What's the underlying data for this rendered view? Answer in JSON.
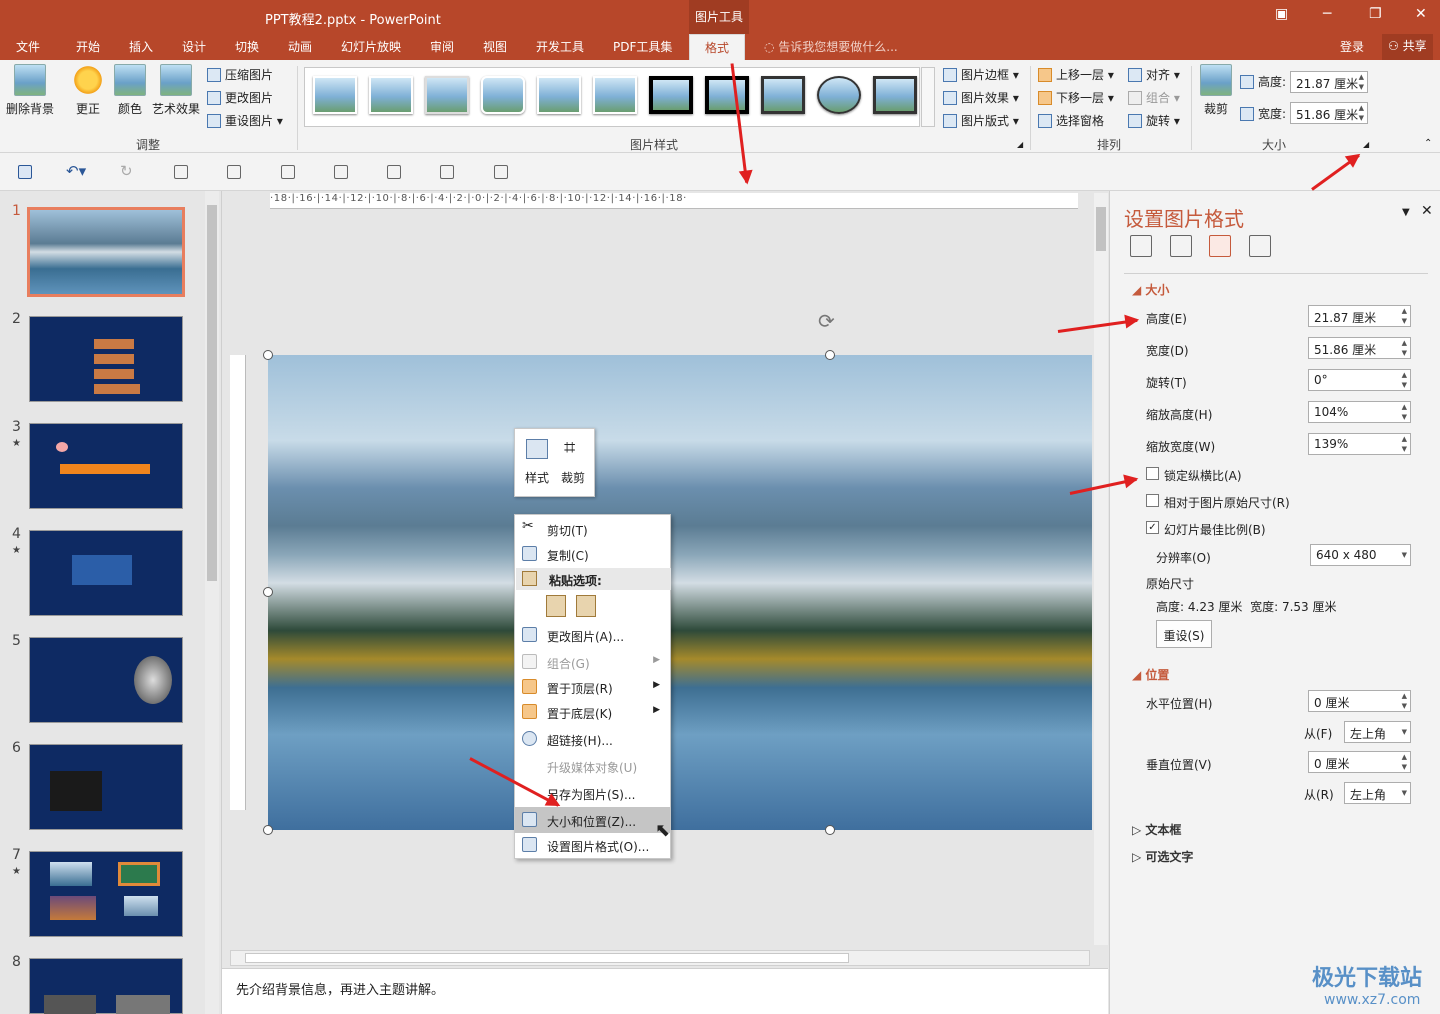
{
  "window": {
    "title": "PPT教程2.pptx - PowerPoint",
    "context_tab_header": "图片工具",
    "minimize": "─",
    "restore": "❐",
    "close": "✕",
    "ribbon_display": "▣"
  },
  "tabs": [
    "文件",
    "开始",
    "插入",
    "设计",
    "切换",
    "动画",
    "幻灯片放映",
    "审阅",
    "视图",
    "开发工具",
    "PDF工具集",
    "格式"
  ],
  "active_tab": "格式",
  "tellme": "告诉我您想要做什么...",
  "account": {
    "login": "登录",
    "share": "共享"
  },
  "ribbon": {
    "adjust": {
      "remove_bg": "删除背景",
      "corrections": "更正",
      "color": "颜色",
      "artistic": "艺术效果",
      "compress": "压缩图片",
      "change": "更改图片",
      "reset": "重设图片",
      "label": "调整"
    },
    "styles": {
      "label": "图片样式",
      "border": "图片边框",
      "effects": "图片效果",
      "layout": "图片版式"
    },
    "arrange": {
      "forward": "上移一层",
      "backward": "下移一层",
      "selection_pane": "选择窗格",
      "align": "对齐",
      "group": "组合",
      "rotate": "旋转",
      "label": "排列"
    },
    "size": {
      "crop": "裁剪",
      "height_label": "高度:",
      "height_value": "21.87 厘米",
      "width_label": "宽度:",
      "width_value": "51.86 厘米",
      "label": "大小"
    }
  },
  "slides": [
    {
      "num": "1",
      "star": ""
    },
    {
      "num": "2",
      "star": ""
    },
    {
      "num": "3",
      "star": "★"
    },
    {
      "num": "4",
      "star": "★"
    },
    {
      "num": "5",
      "star": ""
    },
    {
      "num": "6",
      "star": ""
    },
    {
      "num": "7",
      "star": "★"
    },
    {
      "num": "8",
      "star": ""
    }
  ],
  "ruler": {
    "h": "·18·|·16·|·14·|·12·|·10·|·8·|·6·|·4·|·2·|·0·|·2·|·4·|·6·|·8·|·10·|·12·|·14·|·16·|·18·"
  },
  "mini_toolbar": {
    "style": "样式",
    "crop": "裁剪"
  },
  "context_menu": {
    "cut": "剪切(T)",
    "copy": "复制(C)",
    "paste_options": "粘贴选项:",
    "change_picture": "更改图片(A)...",
    "group": "组合(G)",
    "bring_front": "置于顶层(R)",
    "send_back": "置于底层(K)",
    "hyperlink": "超链接(H)...",
    "upgrade_media": "升级媒体对象(U)",
    "save_as_picture": "另存为图片(S)...",
    "size_position": "大小和位置(Z)...",
    "format_picture": "设置图片格式(O)..."
  },
  "notes": "先介绍背景信息，再进入主题讲解。",
  "pane": {
    "title": "设置图片格式",
    "size_section": "大小",
    "height_label": "高度(E)",
    "height_value": "21.87 厘米",
    "width_label": "宽度(D)",
    "width_value": "51.86 厘米",
    "rotation_label": "旋转(T)",
    "rotation_value": "0°",
    "scale_h_label": "缩放高度(H)",
    "scale_h_value": "104%",
    "scale_w_label": "缩放宽度(W)",
    "scale_w_value": "139%",
    "lock_aspect": "锁定纵横比(A)",
    "relative_original": "相对于图片原始尺寸(R)",
    "best_scale": "幻灯片最佳比例(B)",
    "resolution_label": "分辨率(O)",
    "resolution_value": "640 x 480",
    "original_size": "原始尺寸",
    "orig_h_label": "高度:",
    "orig_h_value": "4.23 厘米",
    "orig_w_label": "宽度:",
    "orig_w_value": "7.53 厘米",
    "reset": "重设(S)",
    "position_section": "位置",
    "hpos_label": "水平位置(H)",
    "hpos_value": "0 厘米",
    "from1_label": "从(F)",
    "from1_value": "左上角",
    "vpos_label": "垂直位置(V)",
    "vpos_value": "0 厘米",
    "from2_label": "从(R)",
    "from2_value": "左上角",
    "textbox_section": "文本框",
    "alt_text_section": "可选文字"
  },
  "watermark": {
    "brand": "极光下载站",
    "url": "www.xz7.com"
  },
  "colors": {
    "accent": "#b7472a",
    "pane_accent": "#c55a3c",
    "arrow": "#e02020"
  }
}
